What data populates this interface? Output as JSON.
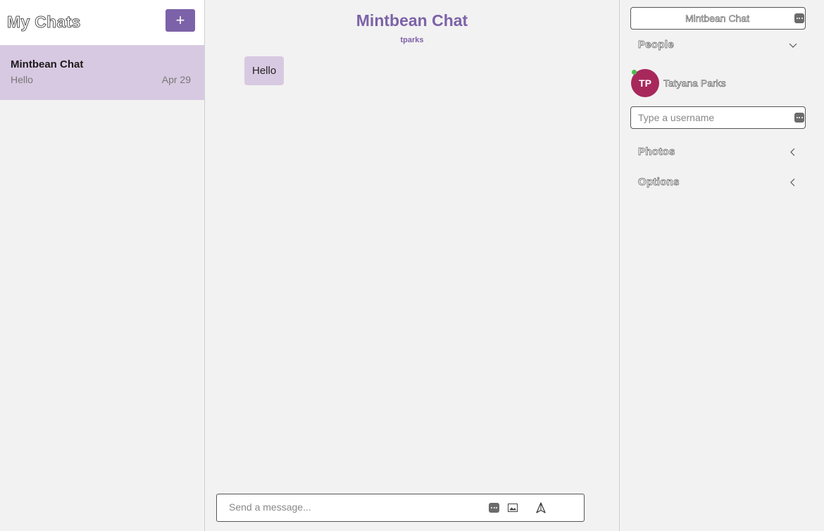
{
  "sidebar": {
    "title": "My Chats",
    "new_chat_label": "+",
    "chats": [
      {
        "title": "Mintbean Chat",
        "last_message": "Hello",
        "date": "Apr 29"
      }
    ]
  },
  "main": {
    "chat_title": "Mintbean Chat",
    "chat_subtitle": "tparks",
    "messages": [
      {
        "text": "Hello"
      }
    ],
    "composer": {
      "placeholder": "Send a message...",
      "icons": [
        "emoji-icon",
        "image-icon",
        "send-icon"
      ]
    }
  },
  "panel": {
    "chat_title_value": "Mintbean Chat",
    "people_label": "People",
    "people": [
      {
        "initials": "TP",
        "name": "Tatyana Parks",
        "online": true
      }
    ],
    "username_placeholder": "Type a username",
    "photos_label": "Photos",
    "options_label": "Options"
  },
  "colors": {
    "accent": "#7c62a8",
    "selected_chat": "#d8c9e2",
    "avatar": "#a8285c",
    "online": "#4cbb4c"
  }
}
